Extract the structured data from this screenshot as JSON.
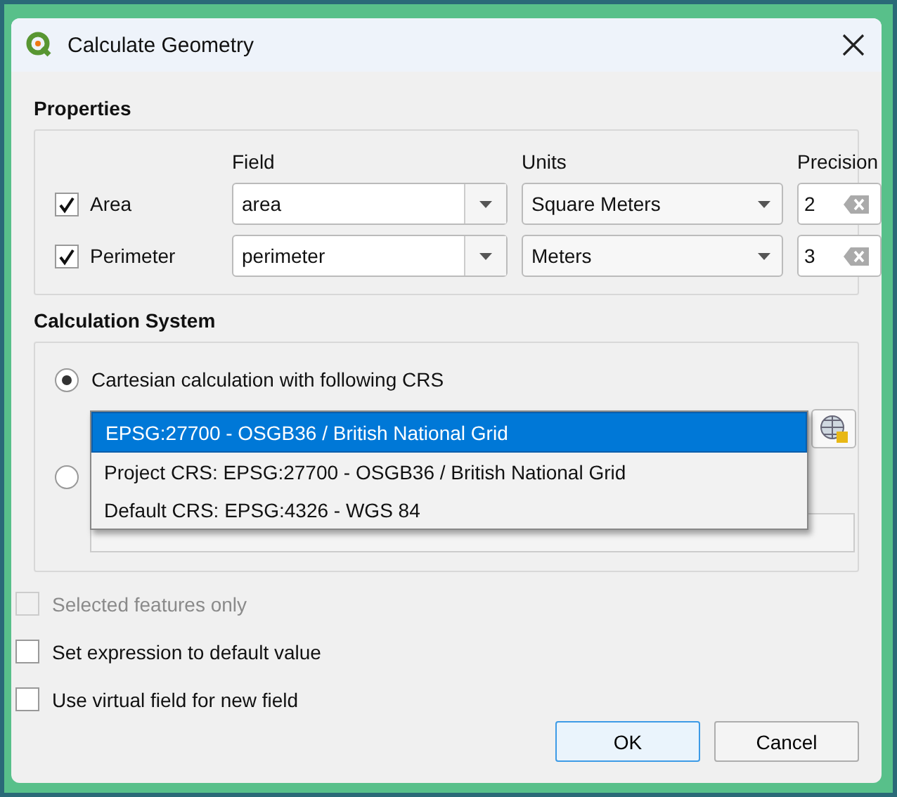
{
  "window": {
    "title": "Calculate Geometry"
  },
  "properties": {
    "title": "Properties",
    "columns": [
      "Field",
      "Units",
      "Precision"
    ],
    "rows": [
      {
        "label": "Area",
        "checked": true,
        "field": "area",
        "units": "Square Meters",
        "precision": "2"
      },
      {
        "label": "Perimeter",
        "checked": true,
        "field": "perimeter",
        "units": "Meters",
        "precision": "3"
      }
    ]
  },
  "calculation_system": {
    "title": "Calculation System",
    "options": [
      {
        "label": "Cartesian calculation with following CRS",
        "selected": true
      },
      {
        "selected": false
      }
    ],
    "crs_dropdown": {
      "items": [
        {
          "label": "EPSG:27700 - OSGB36 / British National Grid",
          "selected": true
        },
        {
          "label": "Project CRS: EPSG:27700 - OSGB36 / British National Grid",
          "selected": false
        },
        {
          "label": "Default CRS: EPSG:4326 - WGS 84",
          "selected": false
        }
      ]
    }
  },
  "options": [
    {
      "label": "Selected features only",
      "checked": false,
      "disabled": true
    },
    {
      "label": "Set expression to default value",
      "checked": false,
      "disabled": false
    },
    {
      "label": "Use virtual field for new field",
      "checked": false,
      "disabled": false
    }
  ],
  "buttons": [
    {
      "label": "OK",
      "default": true
    },
    {
      "label": "Cancel",
      "default": false
    }
  ]
}
